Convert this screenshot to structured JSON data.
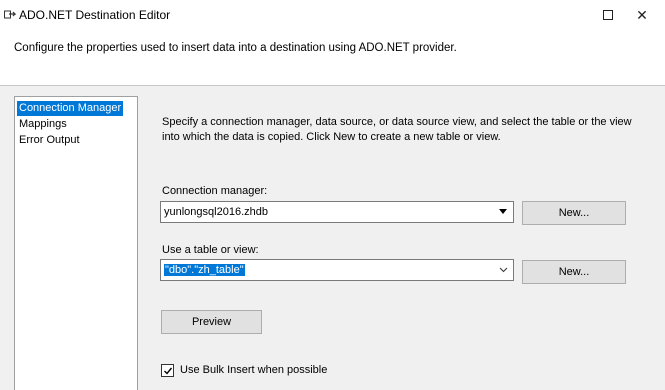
{
  "window": {
    "title": "ADO.NET Destination Editor",
    "maximize_glyph": "",
    "close_glyph": "✕"
  },
  "header": {
    "description": "Configure the properties used to insert data into a destination using ADO.NET provider."
  },
  "nav": {
    "items": [
      {
        "label": "Connection Manager",
        "selected": true
      },
      {
        "label": "Mappings",
        "selected": false
      },
      {
        "label": "Error Output",
        "selected": false
      }
    ]
  },
  "main": {
    "description": "Specify a connection manager, data source, or data source view, and select the table or the view into which the data is copied. Click New to create a new table or view.",
    "connection_manager": {
      "label": "Connection manager:",
      "value": "yunlongsql2016.zhdb",
      "new_label": "New..."
    },
    "table_or_view": {
      "label": "Use a table or view:",
      "value": "\"dbo\".\"zh_table\"",
      "new_label": "New..."
    },
    "preview_label": "Preview",
    "bulk_insert": {
      "label": "Use Bulk Insert when possible",
      "checked": true
    }
  },
  "colors": {
    "selection": "#0078d7",
    "window_bg": "#f0f0f0",
    "header_bg": "#ffffff"
  },
  "icons": {
    "app": "ssis-destination-icon",
    "dropdown": "chevron-down-icon",
    "check": "check-icon"
  }
}
